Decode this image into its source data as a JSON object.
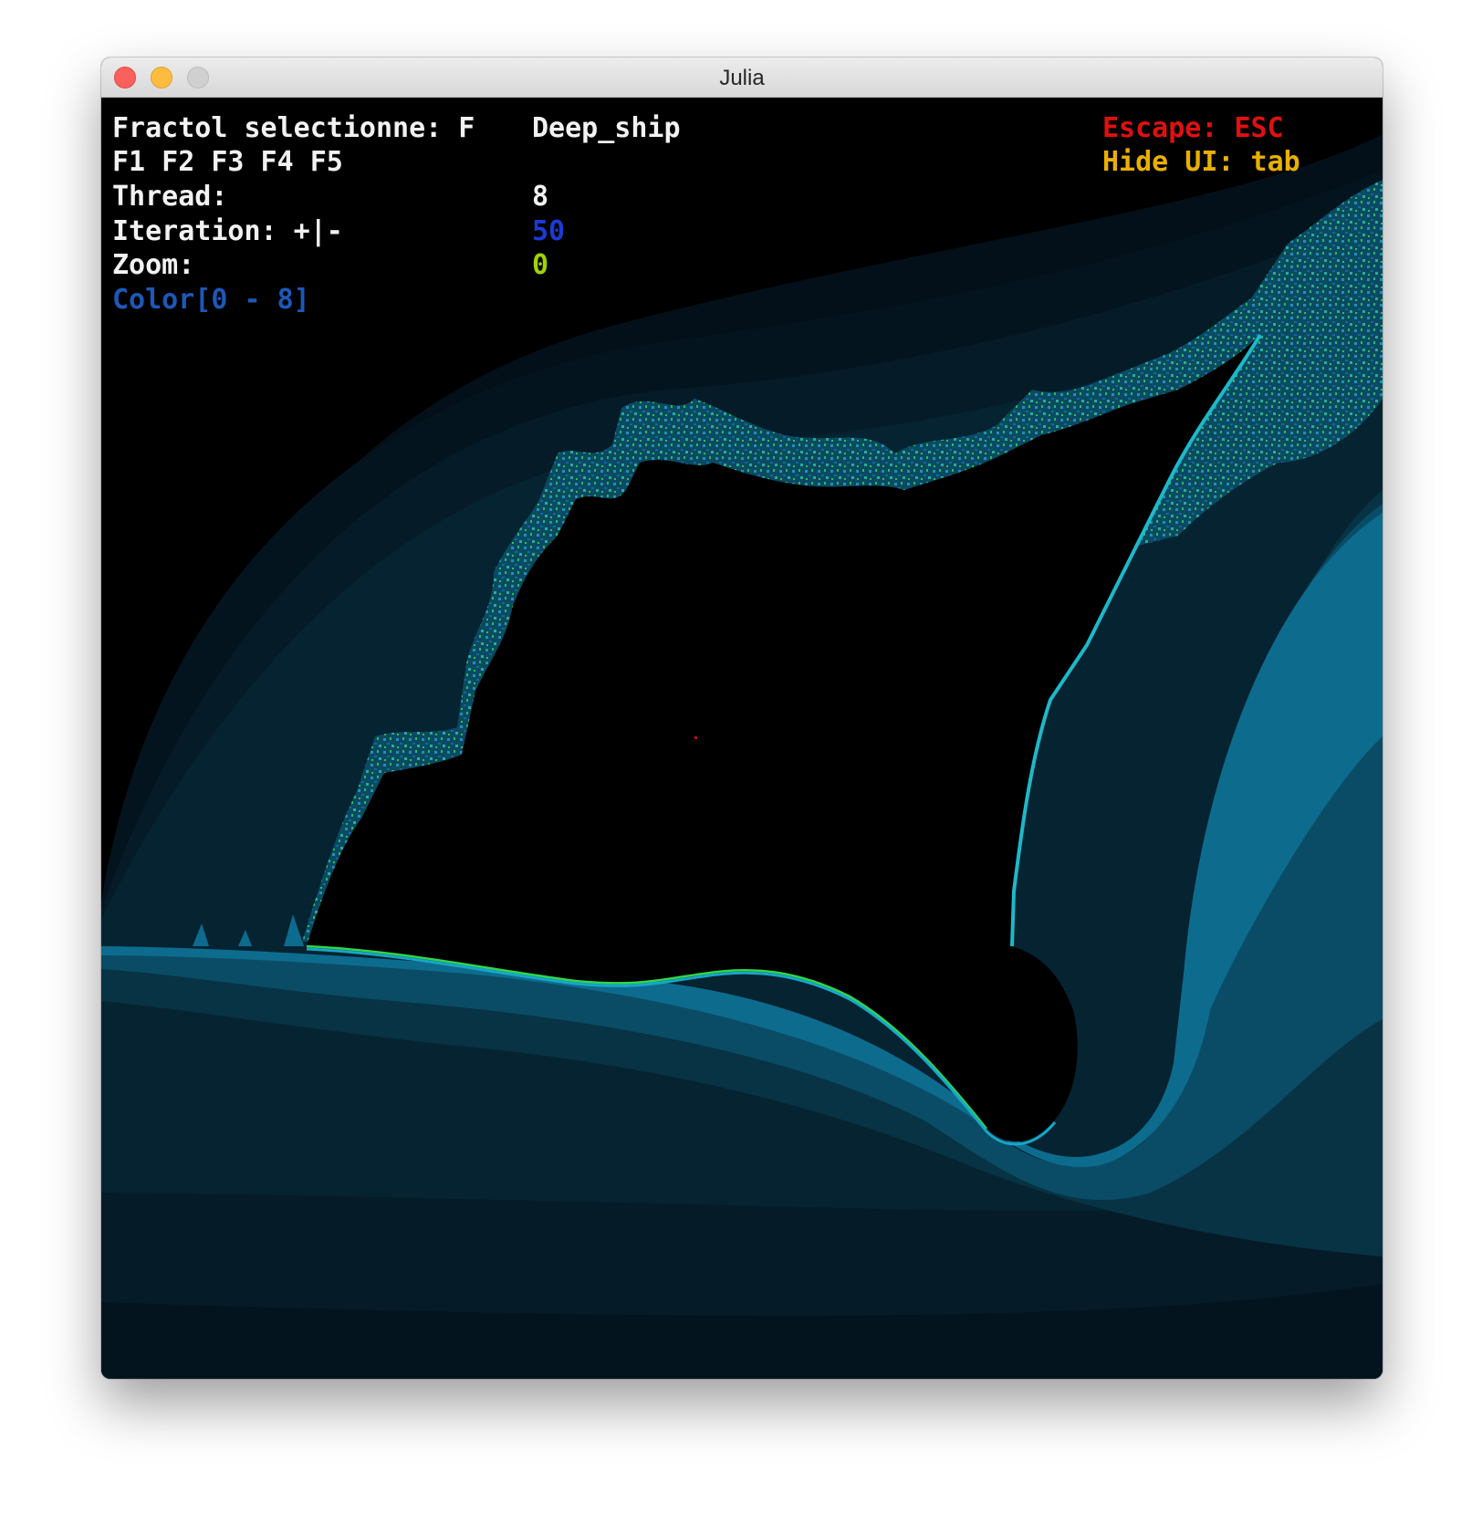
{
  "window": {
    "title": "Julia"
  },
  "hud": {
    "fractal_label": "Fractol selectionne: F",
    "fractal_name": "Deep_ship",
    "fkeys": "F1 F2 F3 F4 F5",
    "thread_label": "Thread:",
    "thread_value": "8",
    "iteration_label": "Iteration: +|-",
    "iteration_value": "50",
    "zoom_label": "Zoom:",
    "zoom_value": "0",
    "color_label": "Color[0 - 8]",
    "escape_label": "Escape: ESC",
    "hide_ui_label": "Hide UI: tab"
  },
  "colors": {
    "text_white": "#f2f2f2",
    "iteration_blue": "#1a3bd6",
    "zoom_green": "#9fd400",
    "color_label_blue": "#1d58b8",
    "escape_red": "#e01010",
    "hide_ui_yellow": "#e9b000",
    "fractal_bands": [
      "#04121a",
      "#052430",
      "#063a4c",
      "#075a74",
      "#0a86a4",
      "#18c4a4",
      "#2fd84c"
    ],
    "set_interior": "#000000"
  }
}
